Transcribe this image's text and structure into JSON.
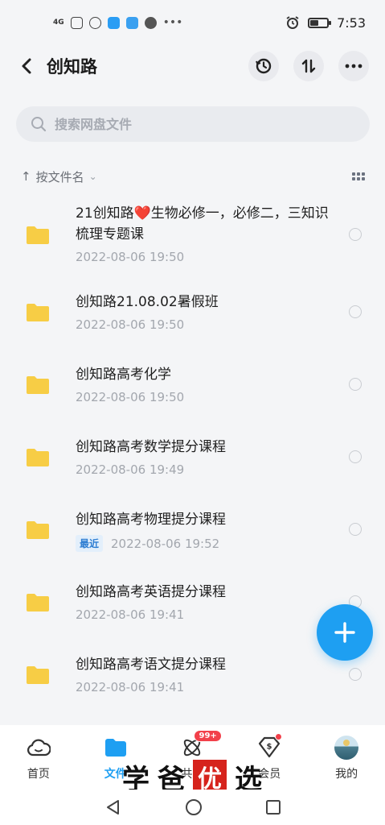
{
  "status_bar": {
    "network": "4G",
    "time": "7:53"
  },
  "header": {
    "title": "创知路",
    "icons": [
      "back-icon",
      "history-icon",
      "sort-icon",
      "more-icon"
    ]
  },
  "search": {
    "placeholder": "搜索网盘文件"
  },
  "sort": {
    "label": "按文件名"
  },
  "files": [
    {
      "name": "21创知路❤️生物必修一，必修二，三知识梳理专题课",
      "date": "2022-08-06  19:50",
      "badge": ""
    },
    {
      "name": "创知路21.08.02暑假班",
      "date": "2022-08-06  19:50",
      "badge": ""
    },
    {
      "name": "创知路高考化学",
      "date": "2022-08-06  19:50",
      "badge": ""
    },
    {
      "name": "创知路高考数学提分课程",
      "date": "2022-08-06  19:49",
      "badge": ""
    },
    {
      "name": "创知路高考物理提分课程",
      "date": "2022-08-06  19:52",
      "badge": "最近"
    },
    {
      "name": "创知路高考英语提分课程",
      "date": "2022-08-06  19:41",
      "badge": ""
    },
    {
      "name": "创知路高考语文提分课程",
      "date": "2022-08-06  19:41",
      "badge": ""
    }
  ],
  "bottom_nav": [
    {
      "label": "首页",
      "icon": "home-cloud-icon",
      "active": false
    },
    {
      "label": "文件",
      "icon": "folder-icon",
      "active": true
    },
    {
      "label": "共享",
      "icon": "share-atom-icon",
      "active": false,
      "badge": "99+"
    },
    {
      "label": "会员",
      "icon": "member-diamond-icon",
      "active": false
    },
    {
      "label": "我的",
      "icon": "avatar",
      "active": false
    }
  ],
  "watermark": {
    "chars": [
      "学",
      "爸",
      "优",
      "选"
    ]
  },
  "colors": {
    "accent": "#1e9ff2",
    "folder": "#f7cd45",
    "badge_red": "#f2404a"
  }
}
